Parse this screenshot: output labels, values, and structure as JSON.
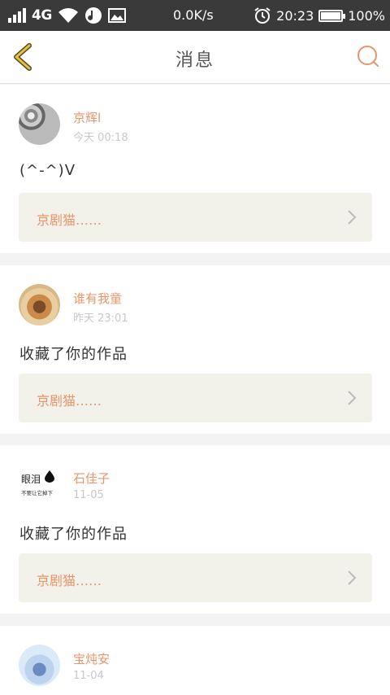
{
  "status_bar": {
    "network": "4G",
    "speed": "0.0K/s",
    "time": "20:23",
    "battery": "100%",
    "battery_level": 1.0
  },
  "header": {
    "title": "消息",
    "back_icon": "chevron-left-icon",
    "search_icon": "search-icon"
  },
  "colors": {
    "accent": "#e8956a",
    "back_icon": "#c9a22a",
    "link_bg": "#f2f1ea"
  },
  "messages": [
    {
      "name": "京辉l",
      "time": "今天 00:18",
      "text": "(^-^)V",
      "link": "京剧猫……"
    },
    {
      "name": "谁有我童",
      "time": "昨天 23:01",
      "text": "收藏了你的作品",
      "link": "京剧猫……"
    },
    {
      "name": "石佳子",
      "time": "11-05",
      "text": "收藏了你的作品",
      "link": "京剧猫……",
      "avatar_text": "眼泪",
      "avatar_subtext": "不要让它掉下"
    },
    {
      "name": "宝炖安",
      "time": "11-04"
    }
  ]
}
